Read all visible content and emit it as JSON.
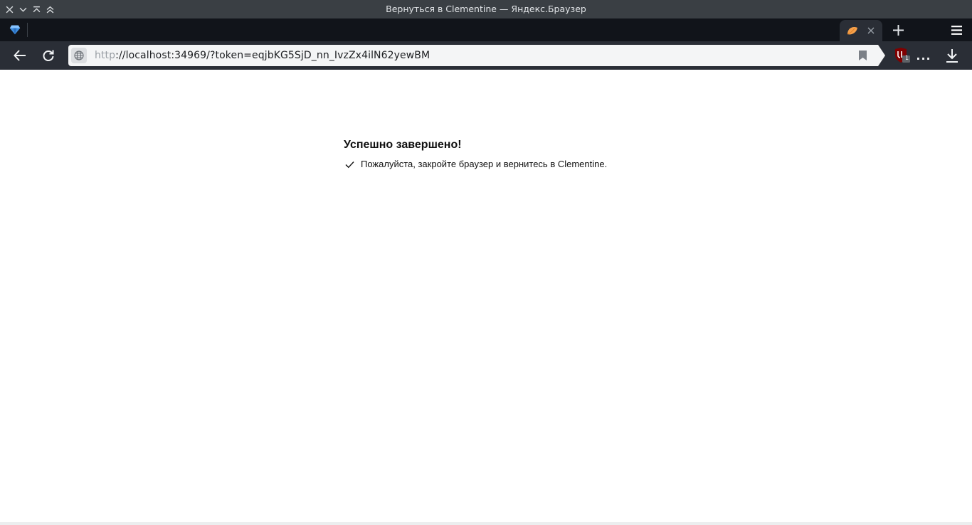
{
  "window": {
    "title": "Вернуться в Clementine — Яндекс.Браузер"
  },
  "toolbar": {
    "url_scheme": "http",
    "url_rest": "://localhost:34969/?token=eqjbKG5SjD_nn_IvzZx4ilN62yewBM",
    "more_label": "...",
    "ublock_badge": "1"
  },
  "page": {
    "heading": "Успешно завершено!",
    "message": "Пожалуйста, закройте браузер и вернитесь в Clementine."
  },
  "icons": {
    "window_close": "close-icon",
    "window_minimize": "chevron-down-icon",
    "window_keep_above": "keep-above-icon",
    "window_maximize": "chevron-up-icon",
    "browser_logo": "yandex-gem-icon",
    "tab_favicon": "clementine-icon",
    "back": "arrow-left-icon",
    "reload": "reload-icon",
    "site_info": "globe-icon",
    "bookmark": "bookmark-icon",
    "extension": "ublock-icon",
    "download": "download-icon",
    "check": "check-icon"
  },
  "colors": {
    "titlebar": "#3a3f44",
    "tabstrip": "#11141a",
    "toolbar": "#2a2e36",
    "omnibox": "#f4f5f6",
    "ublock_red": "#800000"
  }
}
